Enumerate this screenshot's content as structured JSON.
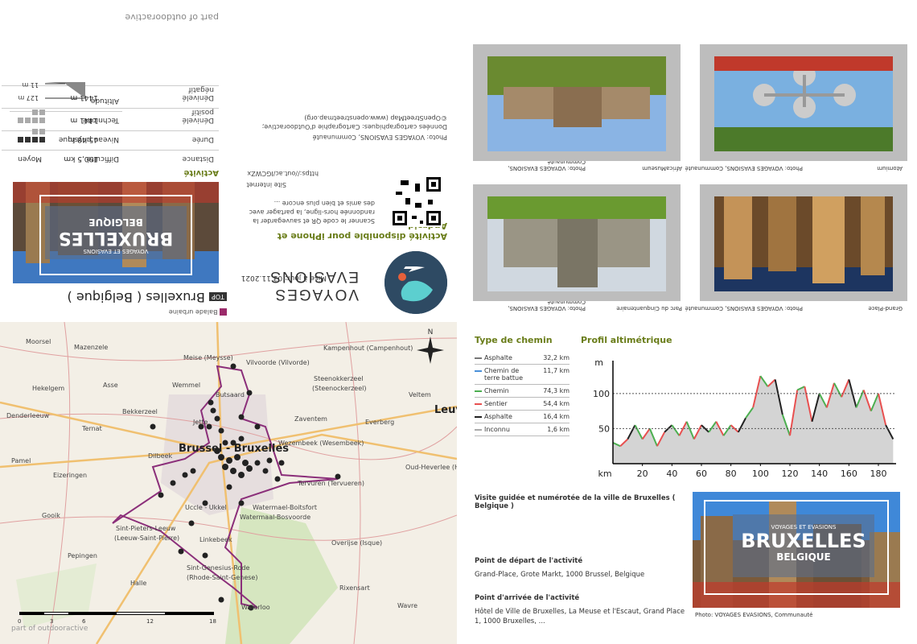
{
  "top_panel": {
    "outdooractive_link": "part of outdooractive",
    "category": "Balade urbaine",
    "top_badge": "TOP",
    "title": "Bruxelles ( Belgique )",
    "brand": "VOYAGES EVASIONS",
    "updated": "Mise à jour: 03.11.2021",
    "app_title": "Activité disponible pour iPhone et Android.",
    "app_text": "Scanner le code QR et sauvegarder la randonnée hors-ligne, la partager avec des amis et bien plus encore ...",
    "site_label": "Site internet",
    "site_url": "https://out.ac/IGCWZx",
    "photo_credit": "Photo: VOYAGES EVASIONS, Communauté",
    "cartography": "Données cartographiques: Cartographie d'Outdooractive; ©OpenStreetMap (www.openstreetmap.org)",
    "cover_title": "BRUXELLES",
    "cover_sub": "BELGIQUE",
    "cover_tag": "VOYAGES ET EVASIONS",
    "activity_title": "Activité",
    "stats": [
      {
        "label": "Distance",
        "value": "190,5 km"
      },
      {
        "label": "Durée",
        "value": "45:48 h."
      },
      {
        "label": "Dénivelé positif",
        "value": "1441 m"
      },
      {
        "label": "Dénivelé négatif",
        "value": "1441 m"
      }
    ],
    "right_stats": [
      {
        "label": "Difficulté",
        "value": "Moyen"
      },
      {
        "label": "Niveau physique",
        "value": ""
      },
      {
        "label": "Technicité",
        "value": ""
      },
      {
        "label": "Altitude",
        "value": ""
      }
    ],
    "altitude_max": "127 m",
    "altitude_min": "11 m",
    "physical_level": 4,
    "technicity_level": 0,
    "level_max": 6
  },
  "photos": [
    {
      "title": "Atomium",
      "credit": "Photo: VOYAGES EVASIONS, Communauté"
    },
    {
      "title": "AfricaMuseum",
      "credit": "Photo: VOYAGES EVASIONS, Communauté"
    },
    {
      "title": "Grand-Place",
      "credit": "Photo: VOYAGES EVASIONS, Communauté"
    },
    {
      "title": "Parc du Cinquantenaire",
      "credit": "Photo: VOYAGES EVASIONS, Communauté"
    }
  ],
  "map": {
    "labels": [
      "Moorsel",
      "Mazenzele",
      "Meise (Meysse)",
      "Vilvoorde (Vilvorde)",
      "Kampenhout (Campenhout)",
      "Hekelgem",
      "Asse",
      "Wemmel",
      "Butsaard",
      "Steenokkerzeel",
      "(Steenockerzeel)",
      "Veltem",
      "Denderleeuw",
      "Bekkerzeel",
      "Zaventem",
      "Everberg",
      "Ternat",
      "Jette",
      "Wezembeek (Wesembeek)",
      "Leuv",
      "Dilbeek",
      "Oud-Heverlee (Hev",
      "Pamel",
      "Tervuren (Tervueren)",
      "Eizeringen",
      "Uccle - Ukkel",
      "Watermael-Boitsfort",
      "Watermaal-Bosvoorde",
      "Gooik",
      "Sint-Pieters-Leeuw",
      "(Leeuw-Saint-Pierre)",
      "Linkebeek",
      "Overijse (Isque)",
      "Pepingen",
      "Sint-Genesius-Rode",
      "(Rhode-Saint-Genese)",
      "Halle",
      "Rixensart",
      "Wavre",
      "Waterloo"
    ],
    "city": "Brussel - Bruxelles",
    "north": "N",
    "scale_ticks": [
      "0",
      "3",
      "6",
      "12",
      "18"
    ],
    "watermark": "part of outdooractive"
  },
  "trail_types": {
    "title": "Type de chemin",
    "rows": [
      {
        "name": "Asphalte",
        "km": "32,2 km",
        "color": "#777777"
      },
      {
        "name": "Chemin de terre battue",
        "km": "11,7 km",
        "color": "#4a90d9"
      },
      {
        "name": "Chemin",
        "km": "74,3 km",
        "color": "#4caf50"
      },
      {
        "name": "Sentier",
        "km": "54,4 km",
        "color": "#e85050"
      },
      {
        "name": "Asphalte",
        "km": "16,4 km",
        "color": "#222222"
      },
      {
        "name": "Inconnu",
        "km": "1,6 km",
        "color": "#aaaaaa"
      }
    ]
  },
  "profile": {
    "title": "Profil altimétrique"
  },
  "chart_data": {
    "type": "area",
    "title": "Profil altimétrique",
    "xlabel": "km",
    "ylabel": "m",
    "x": [
      0,
      5,
      10,
      15,
      20,
      25,
      30,
      35,
      40,
      45,
      50,
      55,
      60,
      65,
      70,
      75,
      80,
      85,
      90,
      95,
      100,
      105,
      110,
      115,
      120,
      125,
      130,
      135,
      140,
      145,
      150,
      155,
      160,
      165,
      170,
      175,
      180,
      185,
      190
    ],
    "values": [
      30,
      25,
      35,
      55,
      35,
      50,
      25,
      45,
      55,
      40,
      60,
      35,
      55,
      45,
      60,
      40,
      55,
      45,
      65,
      80,
      125,
      110,
      120,
      70,
      40,
      105,
      110,
      60,
      100,
      80,
      115,
      95,
      120,
      80,
      105,
      75,
      100,
      55,
      35
    ],
    "xticks": [
      20,
      40,
      60,
      80,
      100,
      120,
      140,
      160,
      180
    ],
    "yticks": [
      50,
      100
    ],
    "xlim": [
      0,
      192
    ],
    "ylim": [
      0,
      140
    ],
    "grid": true
  },
  "details": {
    "description": "Visite guidée et numérotée de la ville de Bruxelles ( Belgique )",
    "start_title": "Point de départ de l'activité",
    "start": "Grand-Place, Grote Markt, 1000 Brussel, Belgique",
    "end_title": "Point d'arrivée de l'activité",
    "end": "Hôtel de Ville de Bruxelles, La Meuse et l'Escaut, Grand Place 1, 1000 Bruxelles, ...",
    "cover_title": "BRUXELLES",
    "cover_sub": "BELGIQUE",
    "cover_tag": "VOYAGES ET EVASIONS",
    "cover_credit": "Photo: VOYAGES EVASIONS, Communauté"
  }
}
